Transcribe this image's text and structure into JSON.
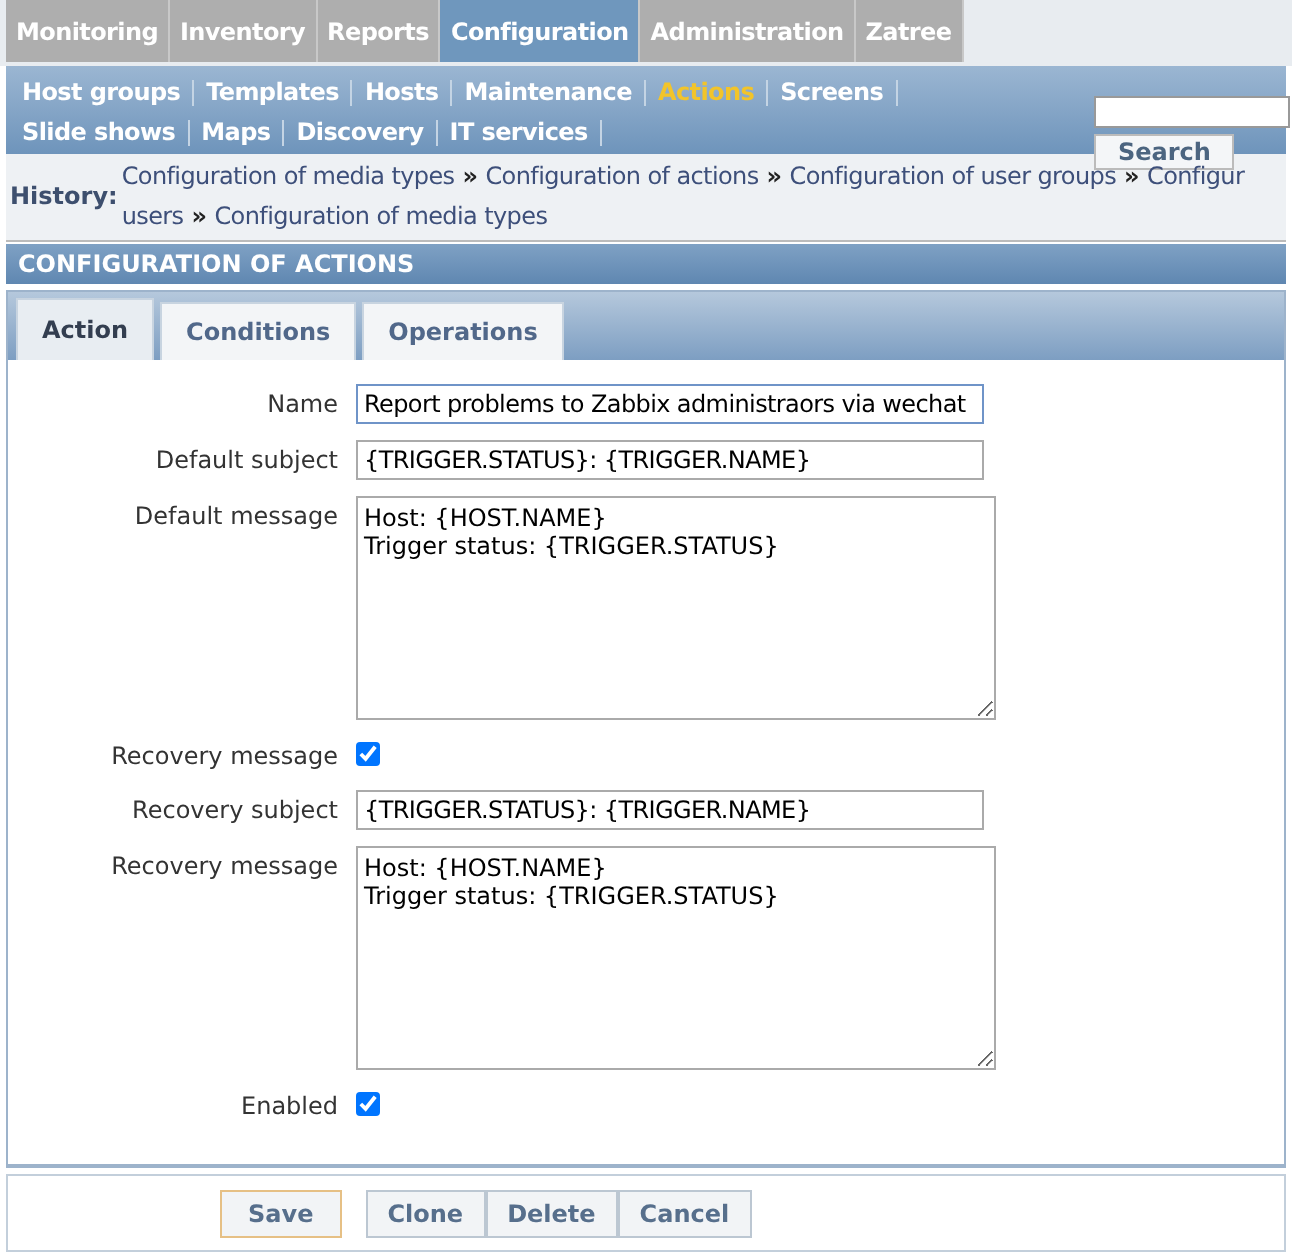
{
  "main_menu": [
    {
      "label": "Monitoring",
      "selected": false
    },
    {
      "label": "Inventory",
      "selected": false
    },
    {
      "label": "Reports",
      "selected": false
    },
    {
      "label": "Configuration",
      "selected": true
    },
    {
      "label": "Administration",
      "selected": false
    },
    {
      "label": "Zatree",
      "selected": false
    }
  ],
  "sub_menu": [
    [
      {
        "label": "Host groups",
        "selected": false
      },
      {
        "label": "Templates",
        "selected": false
      },
      {
        "label": "Hosts",
        "selected": false
      },
      {
        "label": "Maintenance",
        "selected": false
      },
      {
        "label": "Actions",
        "selected": true
      },
      {
        "label": "Screens",
        "selected": false
      }
    ],
    [
      {
        "label": "Slide shows",
        "selected": false
      },
      {
        "label": "Maps",
        "selected": false
      },
      {
        "label": "Discovery",
        "selected": false
      },
      {
        "label": "IT services",
        "selected": false
      }
    ]
  ],
  "search": {
    "button": "Search"
  },
  "history": {
    "label": "History:",
    "lines": [
      [
        {
          "kind": "link",
          "text": "Configuration of media types"
        },
        {
          "kind": "separator",
          "text": "»"
        },
        {
          "kind": "link",
          "text": "Configuration of actions"
        },
        {
          "kind": "separator",
          "text": "»"
        },
        {
          "kind": "link",
          "text": "Configuration of user groups"
        },
        {
          "kind": "separator",
          "text": "»"
        },
        {
          "kind": "link",
          "text": "Configur"
        }
      ],
      [
        {
          "kind": "link",
          "text": "users"
        },
        {
          "kind": "separator",
          "text": "»"
        },
        {
          "kind": "link",
          "text": "Configuration of media types"
        }
      ]
    ]
  },
  "panel": {
    "title": "CONFIGURATION OF ACTIONS"
  },
  "tabs": [
    {
      "label": "Action",
      "selected": true
    },
    {
      "label": "Conditions",
      "selected": false
    },
    {
      "label": "Operations",
      "selected": false
    }
  ],
  "fields": [
    {
      "kind": "text",
      "label": "Name",
      "value": "Report problems to Zabbix administraors via wechat",
      "focused": true
    },
    {
      "kind": "text",
      "label": "Default subject",
      "value": "{TRIGGER.STATUS}: {TRIGGER.NAME}",
      "focused": false
    },
    {
      "kind": "textarea",
      "label": "Default message",
      "value": "Host: {HOST.NAME}\nTrigger status: {TRIGGER.STATUS}"
    },
    {
      "kind": "checkbox",
      "label": "Recovery message",
      "checked": true
    },
    {
      "kind": "text",
      "label": "Recovery subject",
      "value": "{TRIGGER.STATUS}: {TRIGGER.NAME}",
      "focused": false
    },
    {
      "kind": "textarea",
      "label": "Recovery message",
      "value": "Host: {HOST.NAME}\nTrigger status: {TRIGGER.STATUS}"
    },
    {
      "kind": "checkbox",
      "label": "Enabled",
      "checked": true
    }
  ],
  "buttons": [
    {
      "label": "Save",
      "primary": true
    },
    {
      "label": "Clone",
      "primary": false
    },
    {
      "label": "Delete",
      "primary": false
    },
    {
      "label": "Cancel",
      "primary": false
    }
  ]
}
